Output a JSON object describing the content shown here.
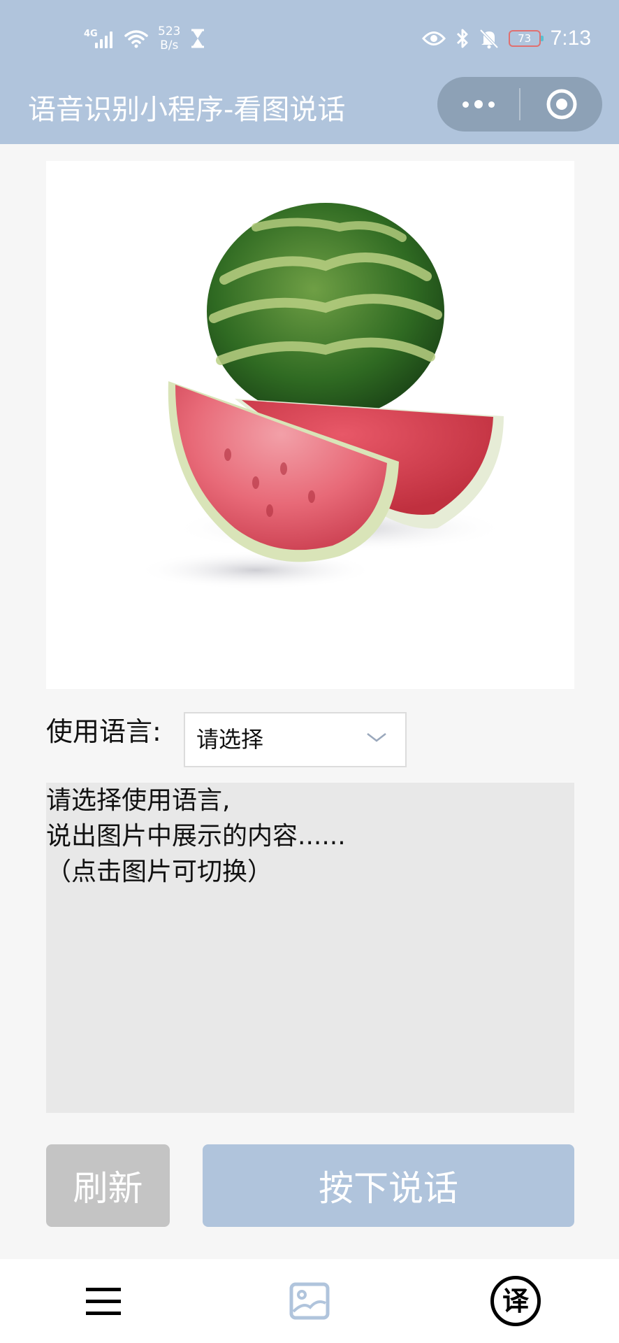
{
  "status_bar": {
    "network_type": "4G",
    "net_speed_value": "523",
    "net_speed_unit": "B/s",
    "battery_level": "73",
    "time": "7:13",
    "icons": [
      "signal-icon",
      "wifi-icon",
      "hourglass-icon",
      "eye-icon",
      "bluetooth-icon",
      "mute-bell-icon",
      "battery-icon"
    ]
  },
  "nav": {
    "title": "语音识别小程序-看图说话",
    "more_icon": "more-dots-icon",
    "close_icon": "target-circle-icon"
  },
  "image": {
    "subject": "watermelon"
  },
  "language": {
    "label": "使用语言:",
    "selected": "请选择"
  },
  "result": {
    "lines": [
      "请选择使用语言,",
      "说出图片中展示的内容......",
      "（点击图片可切换）"
    ]
  },
  "buttons": {
    "refresh": "刷新",
    "speak": "按下说话"
  },
  "tabbar": {
    "items": [
      {
        "icon": "menu-icon"
      },
      {
        "icon": "image-icon"
      },
      {
        "icon": "translate-icon",
        "glyph": "译"
      }
    ]
  },
  "colors": {
    "header": "#b0c4dc",
    "capsule": "#8da1b6",
    "refresh_button": "#c4c4c4",
    "speak_button": "#b0c4dc",
    "result_background": "#e8e8e8"
  }
}
